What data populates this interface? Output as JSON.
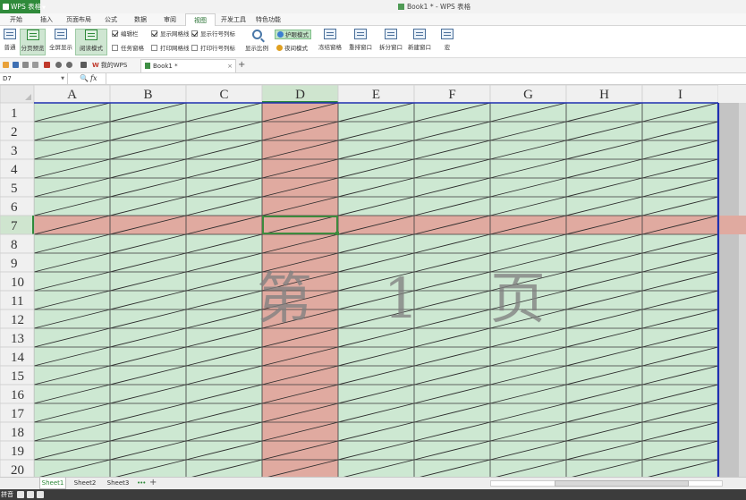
{
  "window": {
    "app_button": "WPS 表格",
    "title": "Book1 * - WPS 表格"
  },
  "menu": {
    "tabs": [
      "开始",
      "插入",
      "页面布局",
      "公式",
      "数据",
      "审阅",
      "视图",
      "开发工具",
      "特色功能"
    ],
    "active": "视图"
  },
  "ribbon": {
    "normal": "普通",
    "page_break": "分页预览",
    "full_screen": "全屏显示",
    "reading_mode": "阅读模式",
    "edit_bar": "编辑栏",
    "task_pane": "任务窗格",
    "show_gridlines": "显示网格线",
    "print_gridlines": "打印网格线",
    "show_headings": "显示行号列标",
    "print_headings": "打印行号列标",
    "zoom": "显示比例",
    "eye_mode": "护眼模式",
    "night_mode": "夜间模式",
    "freeze": "冻结窗格",
    "arrange": "重排窗口",
    "split": "拆分窗口",
    "new_window": "新建窗口",
    "more": "宏"
  },
  "doc_tabs": {
    "mywps": "我的WPS",
    "book1": "Book1 *",
    "add": "+"
  },
  "formula_bar": {
    "cell_ref": "D7",
    "fx": "fx",
    "zoom_glyph": "🔍",
    "value": ""
  },
  "sheet": {
    "columns": [
      "A",
      "B",
      "C",
      "D",
      "E",
      "F",
      "G",
      "H",
      "I"
    ],
    "rows": [
      "1",
      "2",
      "3",
      "4",
      "5",
      "6",
      "7",
      "8",
      "9",
      "10",
      "11",
      "12",
      "13",
      "14",
      "15",
      "16",
      "17",
      "18",
      "19",
      "20"
    ],
    "selected_column": "D",
    "selected_row": "7",
    "watermark": "第 1 页"
  },
  "sheet_tabs": {
    "tabs": [
      "Sheet1",
      "Sheet2",
      "Sheet3"
    ],
    "active": "Sheet1",
    "more": "•••",
    "add": "+"
  },
  "status_bar": {
    "text": "拼音"
  },
  "colors": {
    "page_fill": "#cde8d2",
    "highlight_fill": "#e0aaa0",
    "accent": "#2f8a3a",
    "page_border": "#1f2fb0"
  }
}
